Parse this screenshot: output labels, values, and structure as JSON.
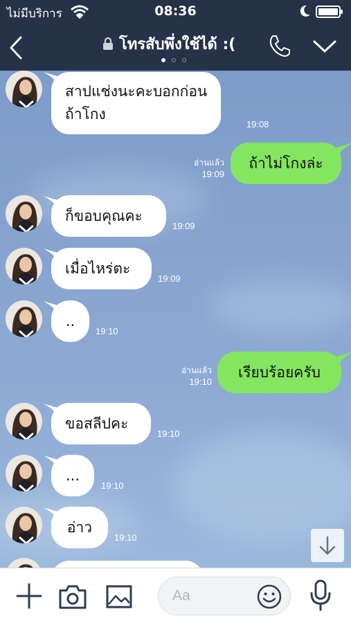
{
  "status_bar": {
    "carrier": "ไม่มีบริการ",
    "time": "08:36"
  },
  "header": {
    "chat_title": "โทรสับพึ่งใช้ได้ :(",
    "page_count": 3,
    "active_page": 1
  },
  "messages": [
    {
      "side": "in",
      "lines": [
        "สาปแช่งนะคะบอกก่อน",
        "ถ้าโกง"
      ],
      "time": "19:08"
    },
    {
      "side": "out",
      "lines": [
        "ถ้าไม่โกงล่ะ"
      ],
      "read": "อ่านแล้ว",
      "time": "19:09"
    },
    {
      "side": "in",
      "lines": [
        "ก็ขอบคุณคะ"
      ],
      "time": "19:09"
    },
    {
      "side": "in",
      "lines": [
        "เมื่อไหร่ตะ"
      ],
      "time": "19:09"
    },
    {
      "side": "in",
      "lines": [
        ".."
      ],
      "time": "19:10"
    },
    {
      "side": "out",
      "lines": [
        "เรียบร้อยครับ"
      ],
      "read": "อ่านแล้ว",
      "time": "19:10"
    },
    {
      "side": "in",
      "lines": [
        "ขอสลีปคะ"
      ],
      "time": "19:10"
    },
    {
      "side": "in",
      "lines": [
        "..."
      ],
      "time": "19:10"
    },
    {
      "side": "in",
      "lines": [
        "อ่าว"
      ],
      "time": "19:10"
    }
  ],
  "input": {
    "placeholder": "Aa"
  },
  "icons": {
    "back": "back-chevron-icon",
    "lock": "lock-icon",
    "call": "phone-icon",
    "menu": "chevron-down-icon",
    "add": "plus-icon",
    "camera": "camera-icon",
    "image": "image-icon",
    "emoji": "emoji-icon",
    "mic": "microphone-icon",
    "scroll": "arrow-down-icon"
  },
  "colors": {
    "header_bg": "#263247",
    "outgoing_bubble": "#84e561",
    "incoming_bubble": "#ffffff",
    "chat_bg": "#86a3cf"
  }
}
